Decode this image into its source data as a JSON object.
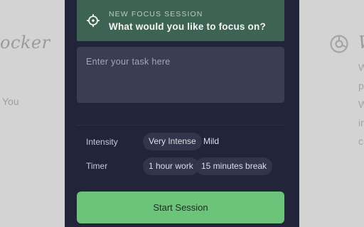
{
  "background": {
    "left_title": "ocker",
    "left_text": "You",
    "right_title": "W",
    "right_lines": [
      "W",
      "p",
      "W",
      "in",
      "c"
    ]
  },
  "session": {
    "label": "NEW FOCUS SESSION",
    "question": "What would you like to focus on?",
    "task_placeholder": "Enter your task here"
  },
  "intensity": {
    "label": "Intensity",
    "options": [
      {
        "label": "Very Intense",
        "selected": true
      },
      {
        "label": "Mild",
        "selected": false
      }
    ]
  },
  "timer": {
    "label": "Timer",
    "options": [
      {
        "label": "1 hour work",
        "selected": true
      },
      {
        "label": "15 minutes break",
        "selected": true
      }
    ]
  },
  "start_button": {
    "label": "Start Session"
  },
  "colors": {
    "panel": "#22253a",
    "header": "#3d6354",
    "input": "#3b3e52",
    "accent": "#6cc47b"
  },
  "icons": {
    "header": "target-icon",
    "background": "pie-chart-icon"
  }
}
